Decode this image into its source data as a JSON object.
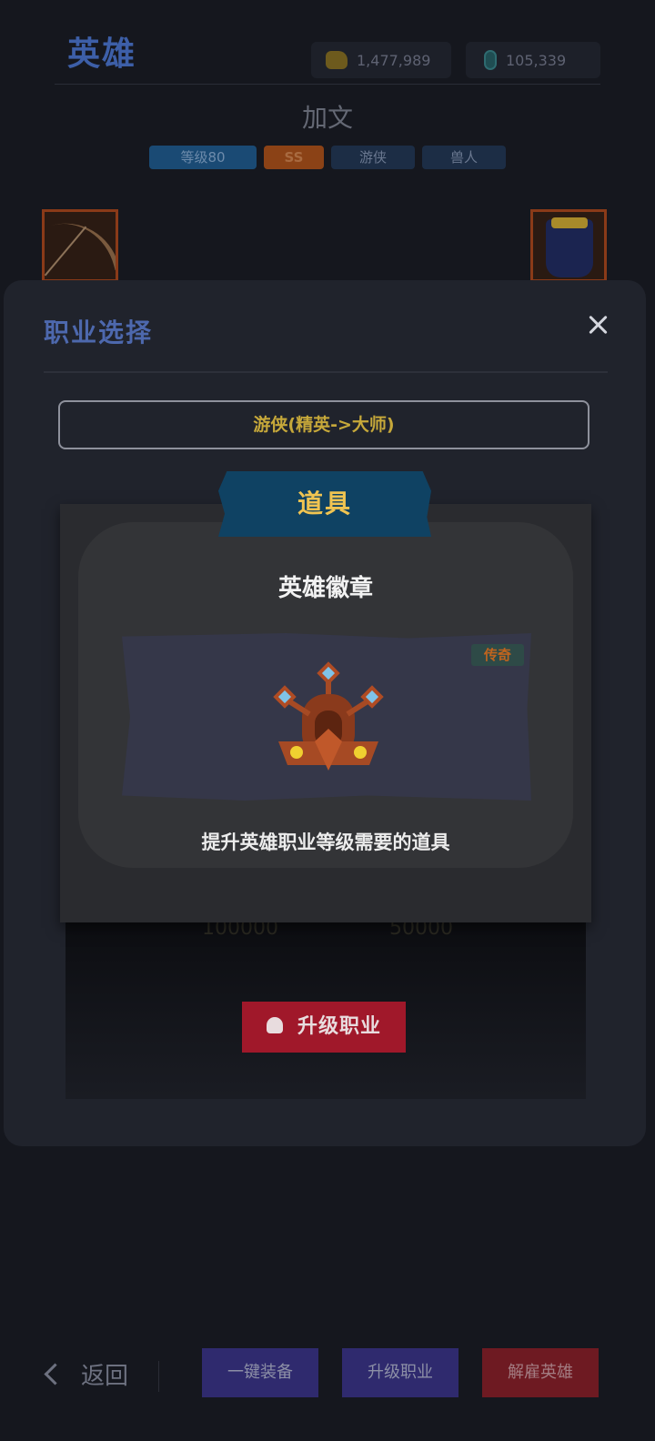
{
  "header": {
    "title": "英雄",
    "gold": "1,477,989",
    "gems": "105,339"
  },
  "hero": {
    "name": "加文",
    "tags": {
      "level": "等级80",
      "rank": "SS",
      "class": "游侠",
      "race": "兽人"
    }
  },
  "modal": {
    "title": "职业选择",
    "class_path": "游侠(精英->大师)",
    "upgrade_label": "升级职业",
    "cost_gold": "100000",
    "cost_gem": "50000"
  },
  "tooltip": {
    "header": "道具",
    "item_name": "英雄徽章",
    "rarity": "传奇",
    "description": "提升英雄职业等级需要的道具"
  },
  "bottom_bar": {
    "back_label": "返回",
    "equip_all_label": "一键装备",
    "upgrade_label": "升级职业",
    "dismiss_label": "解雇英雄"
  },
  "icons": {
    "gold": "gold-coin-icon",
    "gem": "gem-icon",
    "close": "close-icon",
    "back": "chevron-left-icon",
    "upgrade": "user-plus-icon",
    "item": "hero-badge-icon"
  },
  "colors": {
    "background": "#15171e",
    "modal": "#20232c",
    "title_blue": "#4d68ad",
    "class_gold": "#c6a83a",
    "header_blue": "#0f4263",
    "upgrade_red": "#a0182a",
    "rarity_orange": "#c0641e"
  }
}
